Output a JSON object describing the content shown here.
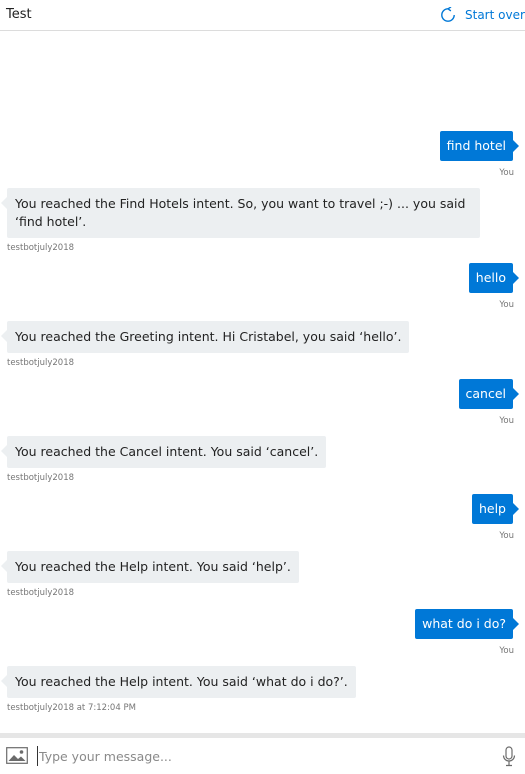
{
  "header": {
    "title": "Test",
    "start_over_label": "Start over"
  },
  "messages": [
    {
      "role": "user",
      "text": "find hotel",
      "meta": "You"
    },
    {
      "role": "bot",
      "text": "You reached the Find Hotels intent. So, you want to travel ;-) ... you said ‘find hotel’.",
      "meta": "testbotjuly2018"
    },
    {
      "role": "user",
      "text": "hello",
      "meta": "You"
    },
    {
      "role": "bot",
      "text": "You reached the Greeting intent. Hi Cristabel, you said ‘hello’.",
      "meta": "testbotjuly2018"
    },
    {
      "role": "user",
      "text": "cancel",
      "meta": "You"
    },
    {
      "role": "bot",
      "text": "You reached the Cancel intent. You said ‘cancel’.",
      "meta": "testbotjuly2018"
    },
    {
      "role": "user",
      "text": "help",
      "meta": "You"
    },
    {
      "role": "bot",
      "text": "You reached the Help intent. You said ‘help’.",
      "meta": "testbotjuly2018"
    },
    {
      "role": "user",
      "text": "what do i do?",
      "meta": "You"
    },
    {
      "role": "bot",
      "text": "You reached the Help intent. You said ‘what do i do?’.",
      "meta": "testbotjuly2018 at 7:12:04 PM"
    }
  ],
  "composer": {
    "placeholder": "Type your message..."
  },
  "icons": {
    "start_over": "refresh-icon",
    "upload": "image-icon",
    "mic": "microphone-icon"
  },
  "colors": {
    "accent": "#0078d7",
    "bot_bubble": "#eceff1"
  }
}
